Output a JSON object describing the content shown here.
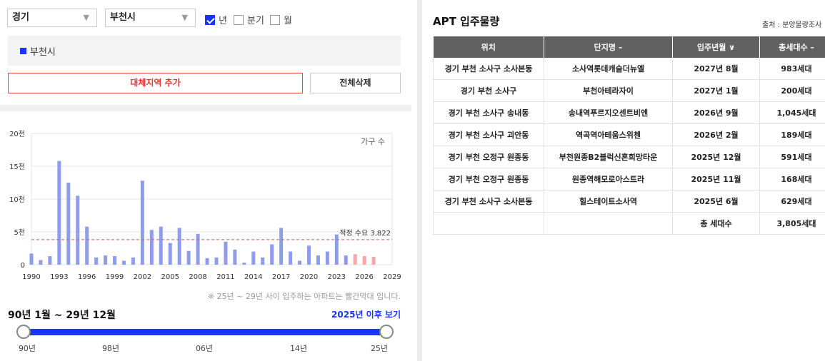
{
  "filters": {
    "province": "경기",
    "city": "부천시",
    "period_options": [
      {
        "label": "년",
        "checked": true
      },
      {
        "label": "분기",
        "checked": false
      },
      {
        "label": "월",
        "checked": false
      }
    ]
  },
  "region_list": [
    "부천시"
  ],
  "buttons": {
    "add_region": "대체지역 추가",
    "delete_all": "전체삭제"
  },
  "chart_data": {
    "type": "bar",
    "legend": "가구 수",
    "y_ticks": [
      "0",
      "5천",
      "10천",
      "15천",
      "20천"
    ],
    "ylim": [
      0,
      20000
    ],
    "x_ticks": [
      "1990",
      "1993",
      "1996",
      "1999",
      "2002",
      "2005",
      "2008",
      "2011",
      "2014",
      "2017",
      "2020",
      "2023",
      "2026",
      "2029"
    ],
    "xlim": [
      1990,
      2029
    ],
    "reference_line": {
      "label": "적정 수요 3,822",
      "value": 3822
    },
    "series": [
      {
        "color": "#8f9cec",
        "x": [
          1990,
          1991,
          1992,
          1993,
          1994,
          1995,
          1996,
          1997,
          1998,
          1999,
          2000,
          2001,
          2002,
          2003,
          2004,
          2005,
          2006,
          2007,
          2008,
          2009,
          2010,
          2011,
          2012,
          2013,
          2014,
          2015,
          2016,
          2017,
          2018,
          2019,
          2020,
          2021,
          2022,
          2023,
          2024
        ],
        "values": [
          1700,
          700,
          1300,
          15800,
          12500,
          10500,
          5800,
          1100,
          1400,
          1300,
          600,
          1100,
          12800,
          5300,
          5800,
          3300,
          5600,
          2100,
          4700,
          1000,
          1100,
          3500,
          2300,
          300,
          2000,
          1100,
          3100,
          5600,
          2000,
          600,
          2900,
          1400,
          2000,
          4600,
          1400
        ]
      },
      {
        "color": "#f5a8a8",
        "x": [
          2025,
          2026,
          2027
        ],
        "values": [
          1600,
          1300,
          1200
        ]
      }
    ]
  },
  "chart_note": "※ 25년 ~ 29년 사이 입주하는 아파트는 빨간막대 입니다.",
  "range": {
    "title": "90년 1월 ~ 29년 12월",
    "link": "2025년 이후 보기",
    "ticks": [
      "90년",
      "98년",
      "06년",
      "14년",
      "25년"
    ]
  },
  "apt": {
    "title": "APT 입주물량",
    "source": "출처 : 분양물량조사",
    "columns": [
      "위치",
      "단지명 –",
      "입주년월 ∨",
      "총세대수 –"
    ],
    "rows": [
      [
        "경기 부천 소사구 소사본동",
        "소사역롯데캐슬더뉴엘",
        "2027년 8월",
        "983세대"
      ],
      [
        "경기 부천 소사구",
        "부천아테라자이",
        "2027년 1월",
        "200세대"
      ],
      [
        "경기 부천 소사구 송내동",
        "송내역푸르지오센트비엔",
        "2026년 9월",
        "1,045세대"
      ],
      [
        "경기 부천 소사구 괴안동",
        "역곡역아테움스위첸",
        "2026년 2월",
        "189세대"
      ],
      [
        "경기 부천 오정구 원종동",
        "부천원종B2블럭신혼희망타운",
        "2025년 12월",
        "591세대"
      ],
      [
        "경기 부천 오정구 원종동",
        "원종역해모로아스트라",
        "2025년 11월",
        "168세대"
      ],
      [
        "경기 부천 소사구 소사본동",
        "힐스테이트소사역",
        "2025년 6월",
        "629세대"
      ],
      [
        "",
        "",
        "총 세대수",
        "3,805세대"
      ]
    ]
  }
}
